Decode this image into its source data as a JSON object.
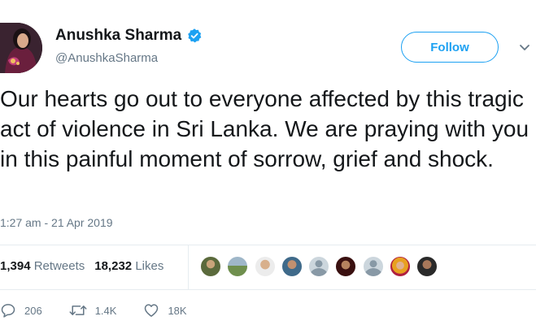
{
  "author": {
    "name": "Anushka Sharma",
    "handle": "@AnushkaSharma",
    "verified": true
  },
  "follow_label": "Follow",
  "tweet": {
    "text": "Our hearts go out to everyone affected by this tragic act of violence in Sri Lanka. We are praying with you in this painful moment of sorrow, grief and shock.",
    "timestamp": "1:27 am - 21 Apr 2019"
  },
  "stats": {
    "retweets_count": "1,394",
    "retweets_label": "Retweets",
    "likes_count": "18,232",
    "likes_label": "Likes"
  },
  "liker_avatars": [
    "photo",
    "photo",
    "photo",
    "photo",
    "default",
    "photo",
    "default",
    "photo",
    "photo"
  ],
  "actions": {
    "replies": "206",
    "retweets": "1.4K",
    "likes": "18K"
  },
  "colors": {
    "accent": "#1da1f2",
    "muted": "#657786",
    "text": "#14171a",
    "divider": "#e6ecf0"
  },
  "icons": [
    "verified-badge-icon",
    "chevron-down-icon",
    "reply-icon",
    "retweet-icon",
    "heart-icon"
  ]
}
